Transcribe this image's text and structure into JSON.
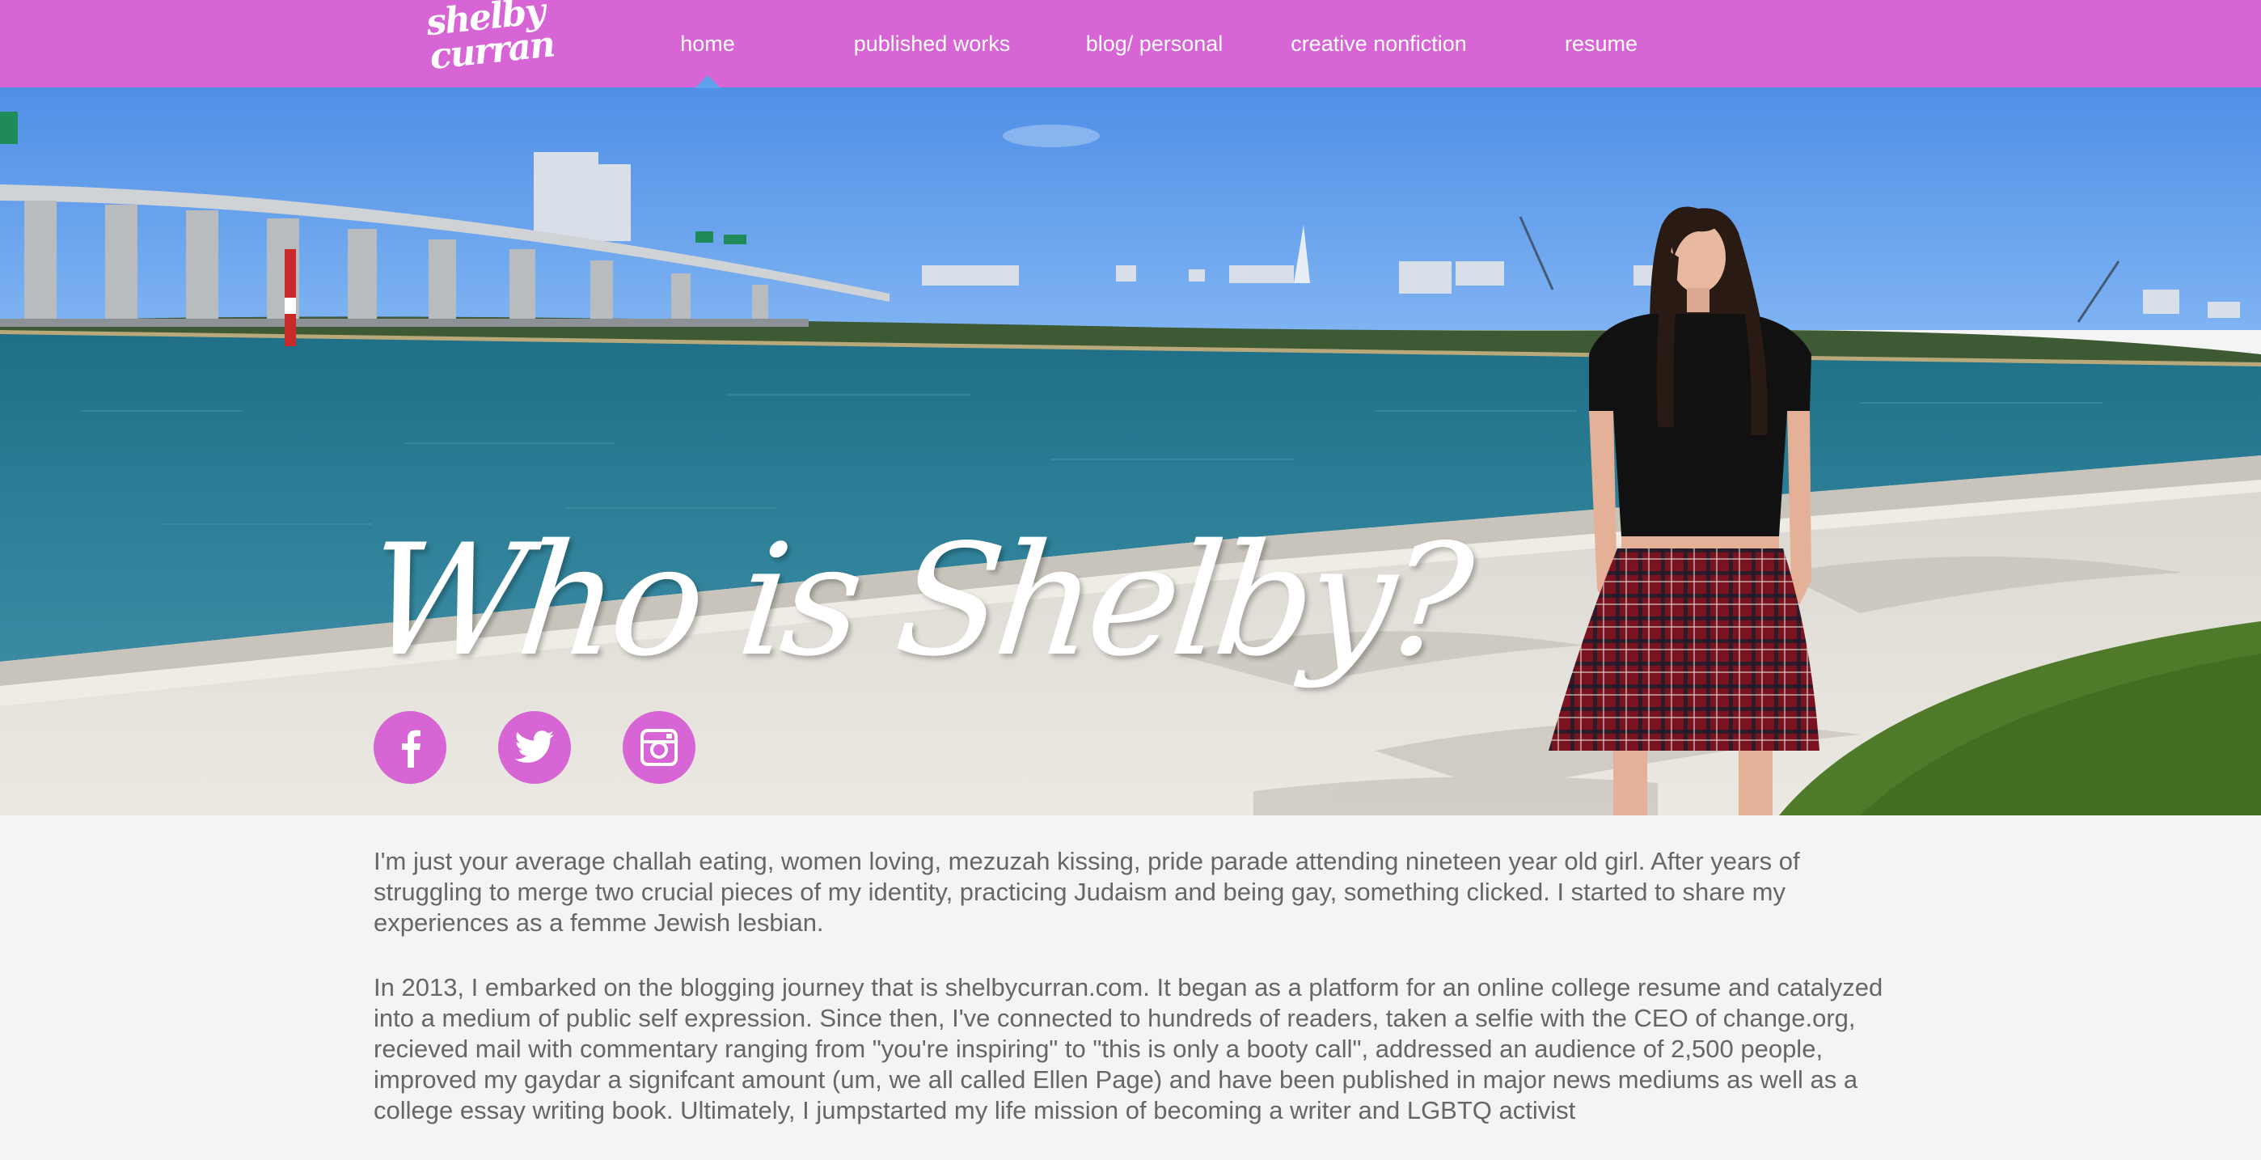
{
  "brand": {
    "logo_line1": "shelby",
    "logo_line2": "curran",
    "accent_color": "#d765d6"
  },
  "nav": {
    "items": [
      {
        "label": "home",
        "active": true
      },
      {
        "label": "published works",
        "active": false
      },
      {
        "label": "blog/ personal",
        "active": false
      },
      {
        "label": "creative nonfiction",
        "active": false
      },
      {
        "label": "resume",
        "active": false
      }
    ]
  },
  "hero": {
    "title": "Who is Shelby?",
    "social": [
      {
        "name": "facebook",
        "icon": "facebook-icon"
      },
      {
        "name": "twitter",
        "icon": "twitter-icon"
      },
      {
        "name": "instagram",
        "icon": "instagram-icon"
      }
    ]
  },
  "content": {
    "paragraphs": [
      "I'm just your average challah eating, women loving, mezuzah kissing, pride parade attending nineteen year old girl. After years of struggling to merge two crucial pieces of my identity, practicing Judaism and being gay, something clicked. I started to share my experiences as a femme Jewish lesbian.",
      "In 2013, I embarked on the blogging journey that is shelbycurran.com. It began as a platform for an online college resume and catalyzed into a medium of public self expression. Since then, I've connected to hundreds of readers, taken a selfie with the CEO of change.org, recieved mail with commentary ranging from \"you're inspiring\" to \"this is only a booty call\", addressed an audience of 2,500 people, improved my gaydar a signifcant amount (um, we all called Ellen Page) and have been published in major news mediums as well as a college essay writing book. Ultimately, I jumpstarted my life mission of becoming a writer and LGBTQ activist"
    ]
  }
}
